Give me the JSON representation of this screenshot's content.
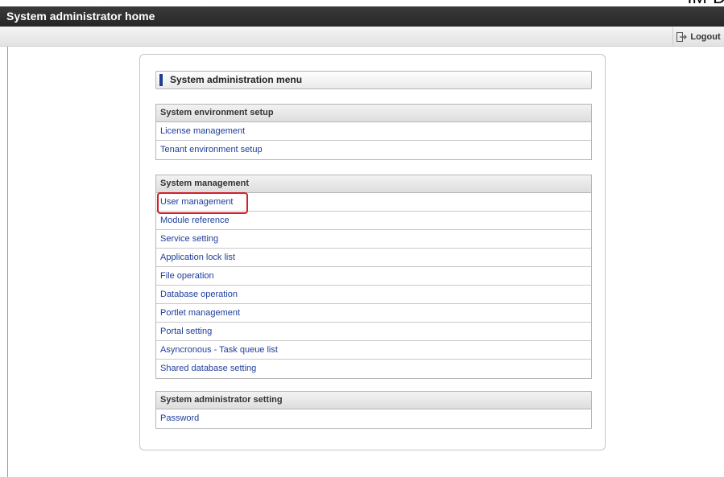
{
  "header": {
    "title": "System administrator home",
    "corner_text": "IM-D"
  },
  "toolbar": {
    "logout_label": "Logout"
  },
  "menu": {
    "title": "System administration menu",
    "sections": [
      {
        "title": "System environment setup",
        "items": [
          "License management",
          "Tenant environment setup"
        ]
      },
      {
        "title": "System management",
        "items": [
          "User management",
          "Module reference",
          "Service setting",
          "Application lock list",
          "File operation",
          "Database operation",
          "Portlet management",
          "Portal setting",
          "Asyncronous - Task queue list",
          "Shared database setting"
        ]
      },
      {
        "title": "System administrator setting",
        "items": [
          "Password"
        ]
      }
    ]
  },
  "colors": {
    "accent": "#1d3f8c",
    "link": "#1e3e9a",
    "highlight": "#d21f2a",
    "header_bg": "#2e2e2e"
  },
  "icons": {
    "logout": "logout-icon"
  }
}
